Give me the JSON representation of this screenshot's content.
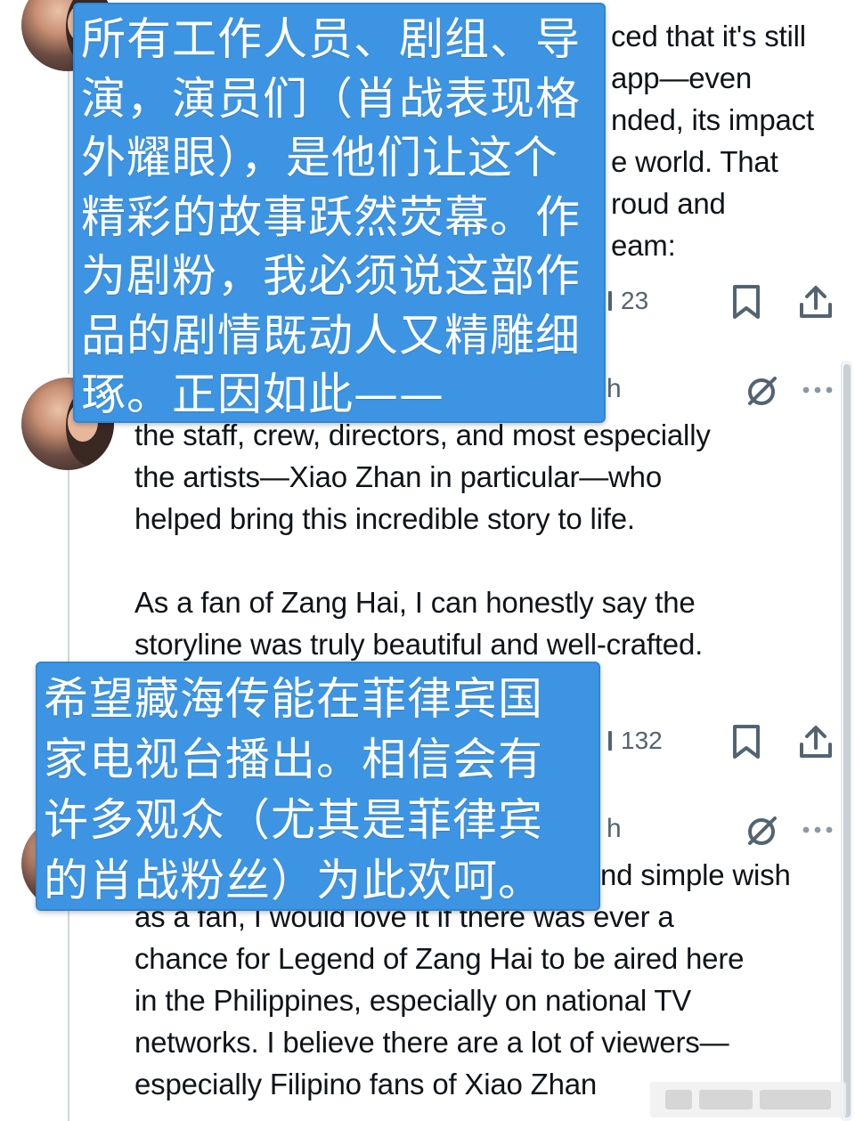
{
  "tweet_1": {
    "lines": [
      "ced that it's still",
      "app—even",
      "nded, its impact",
      "e world. That",
      "roud and",
      "eam:"
    ],
    "reply_count": "23"
  },
  "tweet_2": {
    "header_fragment": "h",
    "paragraph_1_lines": [
      "the staff, crew, directors, and most especially",
      "the artists—Xiao Zhan in particular—who",
      "helped bring this incredible story to life."
    ],
    "paragraph_2_lines": [
      "As a fan of Zang Hai, I can honestly say the",
      "storyline was truly beautiful and well-crafted."
    ],
    "reply_count": "132"
  },
  "tweet_3": {
    "header_fragment": "h",
    "lines": [
      "nd simple wish",
      "as a fan, I would love it if there was ever a",
      "chance for Legend of Zang Hai to be aired here",
      "in the Philippines, especially on national TV",
      "networks. I believe there are a lot of viewers—",
      "especially Filipino fans of Xiao Zhan"
    ]
  },
  "overlay_1": {
    "lines": [
      "所有工作人员、剧组、导",
      "演，演员们（肖战表现格",
      "外耀眼），是他们让这个",
      "精彩的故事跃然荧幕。作",
      "为剧粉，我必须说这部作",
      "品的剧情既动人又精雕细",
      "琢。正因如此——"
    ]
  },
  "overlay_2": {
    "lines": [
      "希望藏海传能在菲律宾国",
      "家电视台播出。相信会有",
      "许多观众（尤其是菲律宾",
      "的肖战粉丝）为此欢呵。"
    ]
  },
  "icons": {
    "reply_bar": "reply-bar-icon",
    "bookmark": "bookmark-icon",
    "share": "share-icon",
    "grok": "grok-icon",
    "more": "more-icon"
  },
  "colors": {
    "overlay_blue": "#3c94e3",
    "text": "#0f1419",
    "muted": "#536471",
    "thread_line": "#cfd9de"
  }
}
